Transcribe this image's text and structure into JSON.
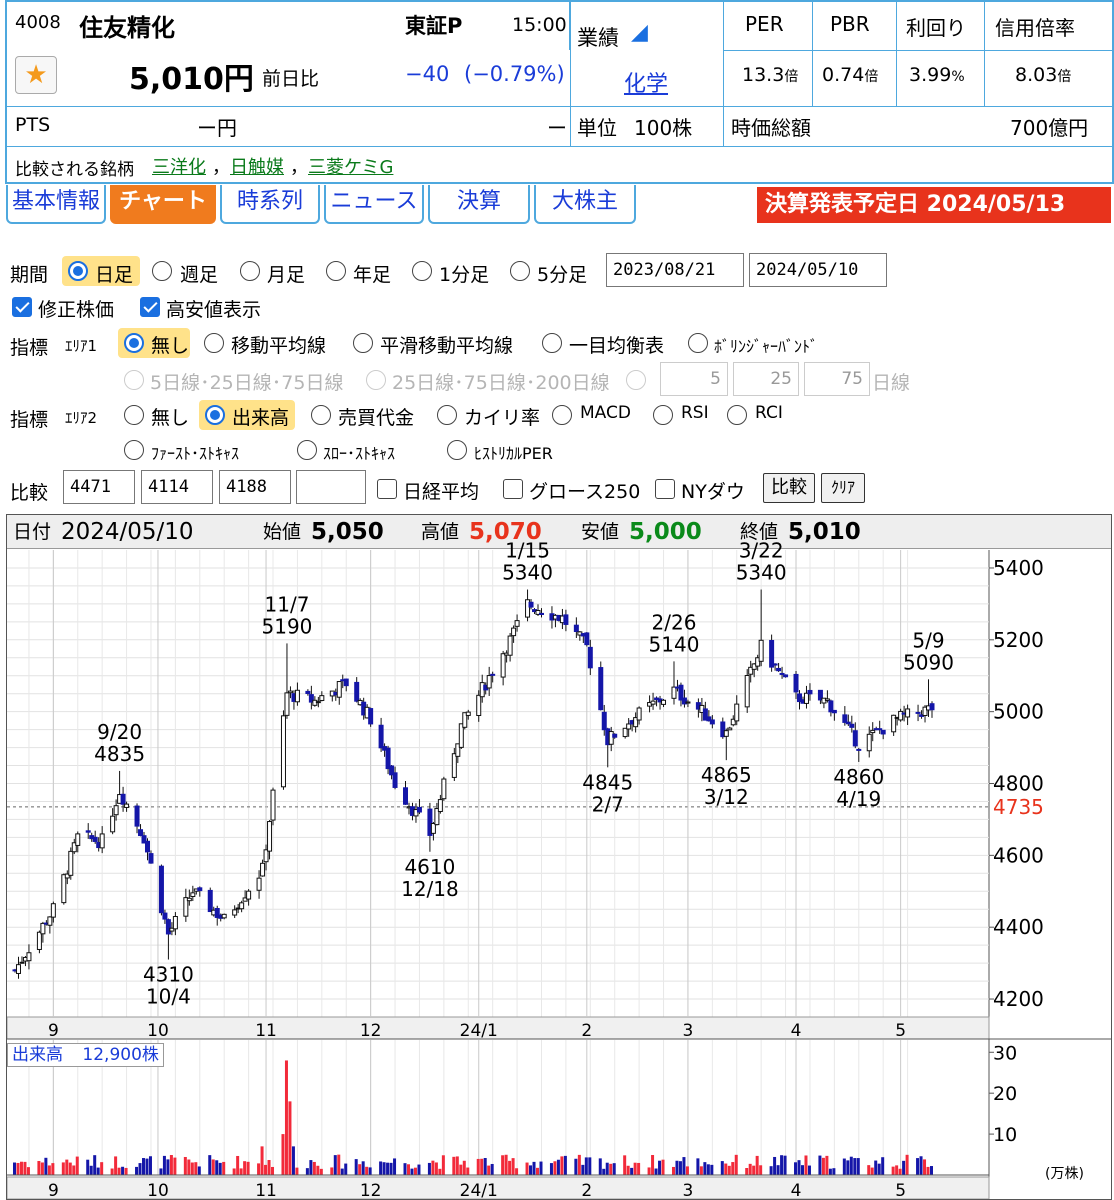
{
  "header": {
    "code_name_prefix": "4008",
    "name": "住友精化",
    "market": "東証P",
    "time": "15:00",
    "price": "5,010円",
    "change_label": "前日比",
    "change": "−40",
    "change_pct": "(−0.79%)",
    "pts_label": "PTS",
    "pts_price": "ー円",
    "pts_change": "ー",
    "gyoseki_label": "業績",
    "sector": "化学",
    "unit_label": "単位",
    "unit_value": "100株",
    "metrics_headers": [
      "PER",
      "PBR",
      "利回り",
      "信用倍率"
    ],
    "metrics_values": [
      {
        "num": "13.3",
        "unit": "倍"
      },
      {
        "num": "0.74",
        "unit": "倍"
      },
      {
        "num": "3.99",
        "unit": "%"
      },
      {
        "num": "8.03",
        "unit": "倍"
      }
    ],
    "market_cap_label": "時価総額",
    "market_cap_value": "700億円",
    "compare_label": "比較される銘柄",
    "compare_links": [
      "三洋化",
      "日触媒",
      "三菱ケミG"
    ],
    "compare_sep": "，"
  },
  "tabs": [
    "基本情報",
    "チャート",
    "時系列",
    "ニュース",
    "決算",
    "大株主"
  ],
  "active_tab": 1,
  "banner": "決算発表予定日 2024/05/13",
  "controls": {
    "period_label": "期間",
    "period_options": [
      "日足",
      "週足",
      "月足",
      "年足",
      "1分足",
      "5分足"
    ],
    "period_selected": 0,
    "date_from": "2023/08/21",
    "date_to": "2024/05/10",
    "adjusted_label": "修正株価",
    "highlow_label": "高安値表示",
    "ind1_label": "指標",
    "ind1_area": "ｴﾘｱ1",
    "ind1_options": [
      "無し",
      "移動平均線",
      "平滑移動平均線",
      "一目均衡表",
      "ﾎﾞﾘﾝｼﾞｬｰﾊﾞﾝﾄﾞ"
    ],
    "ind1_sub_options": [
      "5日線･25日線･75日線",
      "25日線･75日線･200日線"
    ],
    "ind1_inputs": [
      "5",
      "25",
      "75"
    ],
    "ind1_input_suffix": "日線",
    "ind2_label": "指標",
    "ind2_area": "ｴﾘｱ2",
    "ind2_options": [
      "無し",
      "出来高",
      "売買代金",
      "カイリ率",
      "MACD",
      "RSI",
      "RCI"
    ],
    "ind2_options_row2": [
      "ﾌｧｰｽﾄ･ｽﾄｷｬｽ",
      "ｽﾛｰ･ｽﾄｷｬｽ",
      "ﾋｽﾄﾘｶﾙPER"
    ],
    "compare_label": "比較",
    "compare_codes": [
      "4471",
      "4114",
      "4188",
      ""
    ],
    "compare_checks": [
      "日経平均",
      "グロース250",
      "NYダウ"
    ],
    "btn_compare": "比較",
    "btn_clear": "ｸﾘｱ"
  },
  "ohlc": {
    "date_label": "日付",
    "date": "2024/05/10",
    "open_label": "始値",
    "open": "5,050",
    "high_label": "高値",
    "high": "5,070",
    "low_label": "安値",
    "low": "5,000",
    "close_label": "終値",
    "close": "5,010"
  },
  "colors": {
    "up": "#f22a3a",
    "down": "#1416a8",
    "high": "#e8331c",
    "low": "#0a8a1a",
    "ref_line_label": "#e8331c",
    "accent": "#4ea8de"
  },
  "chart_data": {
    "type": "candlestick",
    "period": "daily",
    "yaxis_ticks": [
      4200,
      4400,
      4600,
      4800,
      5000,
      5200,
      5400
    ],
    "ylim": [
      4150,
      5450
    ],
    "reference_line": 4735,
    "xaxis_labels": [
      "9",
      "10",
      "11",
      "12",
      "24/1",
      "2",
      "3",
      "4",
      "5"
    ],
    "annotations": [
      {
        "date": "9/20",
        "value": "4835",
        "label_top": "9/20",
        "label_bottom": "4835"
      },
      {
        "date": "10/4",
        "value": "4310",
        "label_top": "4310",
        "label_bottom": "10/4"
      },
      {
        "date": "11/7",
        "value": "5190",
        "label_top": "11/7",
        "label_bottom": "5190"
      },
      {
        "date": "12/18",
        "value": "4610",
        "label_top": "4610",
        "label_bottom": "12/18"
      },
      {
        "date": "1/15",
        "value": "5340",
        "label_top": "1/15",
        "label_bottom": "5340"
      },
      {
        "date": "2/7",
        "value": "4845",
        "label_top": "4845",
        "label_bottom": "2/7"
      },
      {
        "date": "2/26",
        "value": "5140",
        "label_top": "2/26",
        "label_bottom": "5140"
      },
      {
        "date": "3/12",
        "value": "4865",
        "label_top": "4865",
        "label_bottom": "3/12"
      },
      {
        "date": "3/22",
        "value": "5340",
        "label_top": "3/22",
        "label_bottom": "5340"
      },
      {
        "date": "4/19",
        "value": "4860",
        "label_top": "4860",
        "label_bottom": "4/19"
      },
      {
        "date": "5/9",
        "value": "5090",
        "label_top": "5/9",
        "label_bottom": "5090"
      }
    ],
    "close_path": [
      {
        "month": "2023-08-21",
        "close": 4280
      },
      {
        "month": "2023-09-01",
        "close": 4450
      },
      {
        "month": "2023-09-08",
        "close": 4650
      },
      {
        "month": "2023-09-15",
        "close": 4640
      },
      {
        "month": "2023-09-20",
        "close": 4780
      },
      {
        "month": "2023-09-27",
        "close": 4650
      },
      {
        "month": "2023-10-04",
        "close": 4380
      },
      {
        "month": "2023-10-11",
        "close": 4500
      },
      {
        "month": "2023-10-20",
        "close": 4420
      },
      {
        "month": "2023-10-31",
        "close": 4560
      },
      {
        "month": "2023-11-07",
        "close": 5050
      },
      {
        "month": "2023-11-15",
        "close": 5030
      },
      {
        "month": "2023-11-24",
        "close": 5080
      },
      {
        "month": "2023-12-01",
        "close": 4980
      },
      {
        "month": "2023-12-08",
        "close": 4800
      },
      {
        "month": "2023-12-18",
        "close": 4660
      },
      {
        "month": "2023-12-27",
        "close": 4960
      },
      {
        "month": "2024-01-10",
        "close": 5200
      },
      {
        "month": "2024-01-15",
        "close": 5300
      },
      {
        "month": "2024-01-25",
        "close": 5260
      },
      {
        "month": "2024-02-01",
        "close": 5180
      },
      {
        "month": "2024-02-07",
        "close": 4920
      },
      {
        "month": "2024-02-14",
        "close": 4980
      },
      {
        "month": "2024-02-26",
        "close": 5060
      },
      {
        "month": "2024-03-05",
        "close": 5000
      },
      {
        "month": "2024-03-12",
        "close": 4940
      },
      {
        "month": "2024-03-22",
        "close": 5180
      },
      {
        "month": "2024-04-01",
        "close": 5040
      },
      {
        "month": "2024-04-10",
        "close": 5030
      },
      {
        "month": "2024-04-19",
        "close": 4910
      },
      {
        "month": "2024-04-30",
        "close": 4980
      },
      {
        "month": "2024-05-10",
        "close": 5010
      }
    ],
    "volume": {
      "label": "出来高",
      "latest": "12,900株",
      "unit": "(万株)",
      "yaxis_ticks": [
        10,
        20,
        30
      ],
      "peak_value": 28
    }
  }
}
